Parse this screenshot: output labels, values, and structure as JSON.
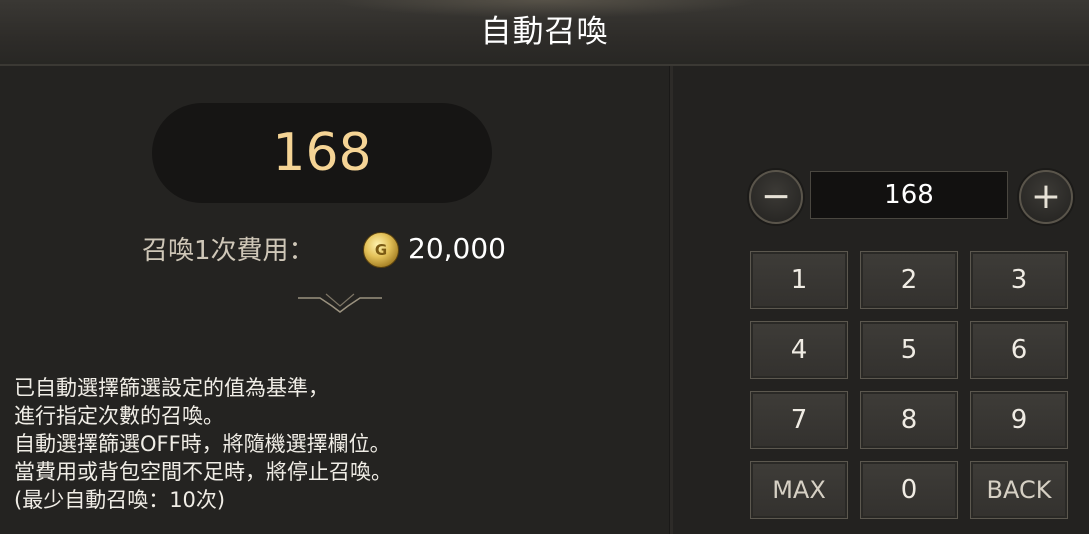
{
  "header": {
    "title": "自動召喚"
  },
  "summon": {
    "count_display": "168",
    "cost_label": "召喚1次費用：",
    "cost_icon": "gold-coin-icon",
    "cost_value": "20,000"
  },
  "description": {
    "lines": [
      "已自動選擇篩選設定的值為基準，",
      "進行指定次數的召喚。",
      "自動選擇篩選OFF時，將隨機選擇欄位。",
      "當費用或背包空間不足時，將停止召喚。",
      "(最少自動召喚：10次)"
    ]
  },
  "stepper": {
    "minus_label": "−",
    "plus_label": "+",
    "value": "168"
  },
  "keypad": {
    "keys": [
      "1",
      "2",
      "3",
      "4",
      "5",
      "6",
      "7",
      "8",
      "9",
      "MAX",
      "0",
      "BACK"
    ]
  },
  "colors": {
    "accent_value": "#f5d495",
    "background": "#222120",
    "key_border": "#5c584f"
  }
}
